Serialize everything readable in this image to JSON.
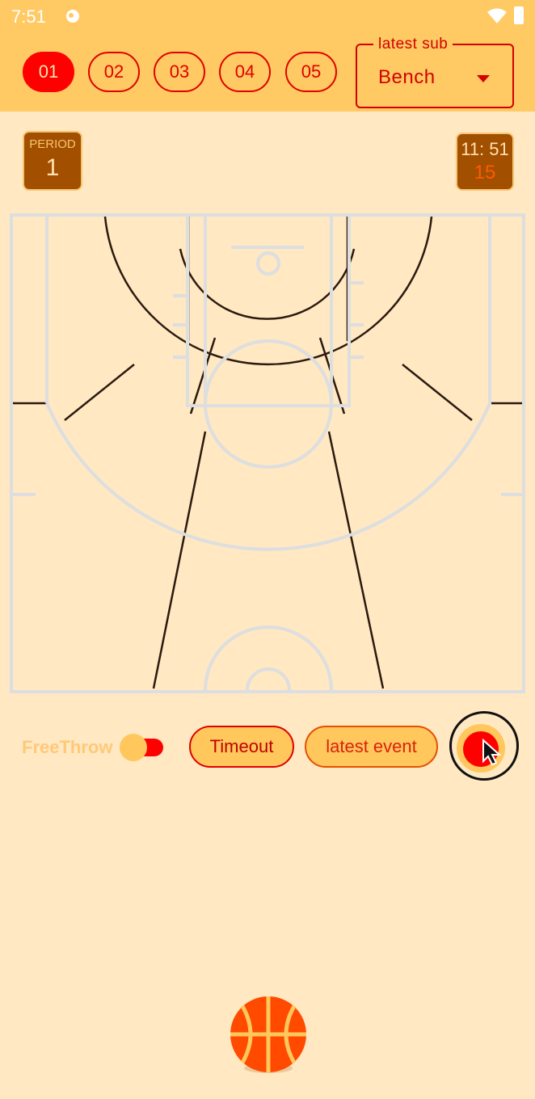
{
  "status_bar": {
    "time": "7:51"
  },
  "players": [
    "01",
    "02",
    "03",
    "04",
    "05"
  ],
  "active_player": "01",
  "latest_sub": {
    "label": "latest sub",
    "value": "Bench"
  },
  "period": {
    "label": "PERIOD",
    "value": "1"
  },
  "clock": {
    "game_time": "11: 51",
    "shot_clock": "15"
  },
  "controls": {
    "free_throw_label": "FreeThrow",
    "timeout_label": "Timeout",
    "latest_event_label": "latest event"
  },
  "colors": {
    "header": "#FFCA63",
    "background": "#FFE8C2",
    "accent_red": "#FF0000",
    "period_card": "#A34F00",
    "ball": "#FF4A00"
  },
  "icons": [
    "notification-icon",
    "wifi-icon",
    "battery-icon",
    "dropdown-arrow-icon",
    "record-icon",
    "basketball-icon",
    "cursor-icon"
  ]
}
